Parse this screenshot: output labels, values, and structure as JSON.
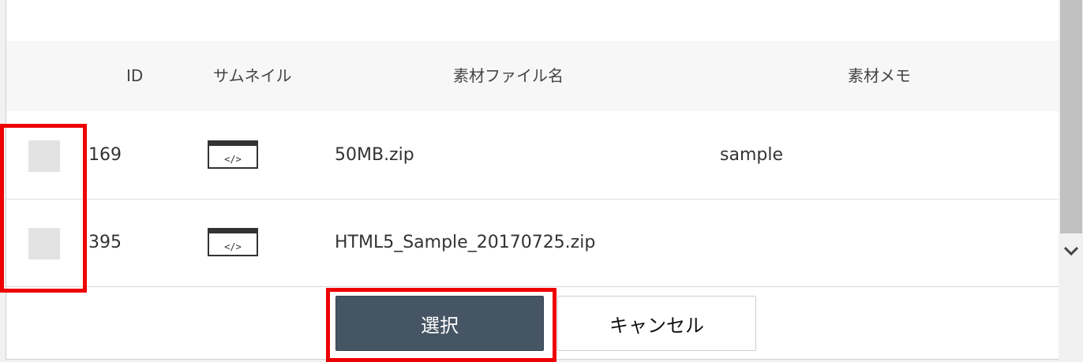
{
  "table": {
    "columns": {
      "id": "ID",
      "thumbnail": "サムネイル",
      "filename": "素材ファイル名",
      "memo": "素材メモ"
    },
    "rows": [
      {
        "id": "169",
        "thumbnail_icon": "code-file-icon",
        "filename": "50MB.zip",
        "memo": "sample"
      },
      {
        "id": "395",
        "thumbnail_icon": "code-file-icon",
        "filename": "HTML5_Sample_20170725.zip",
        "memo": ""
      }
    ]
  },
  "buttons": {
    "select": "選択",
    "cancel": "キャンセル"
  },
  "annotations": {
    "highlight_color": "#ee0000"
  },
  "colors": {
    "select_button_bg": "#455563",
    "header_bg": "#f7f7f7",
    "checkbox_bg": "#e3e3e3"
  }
}
